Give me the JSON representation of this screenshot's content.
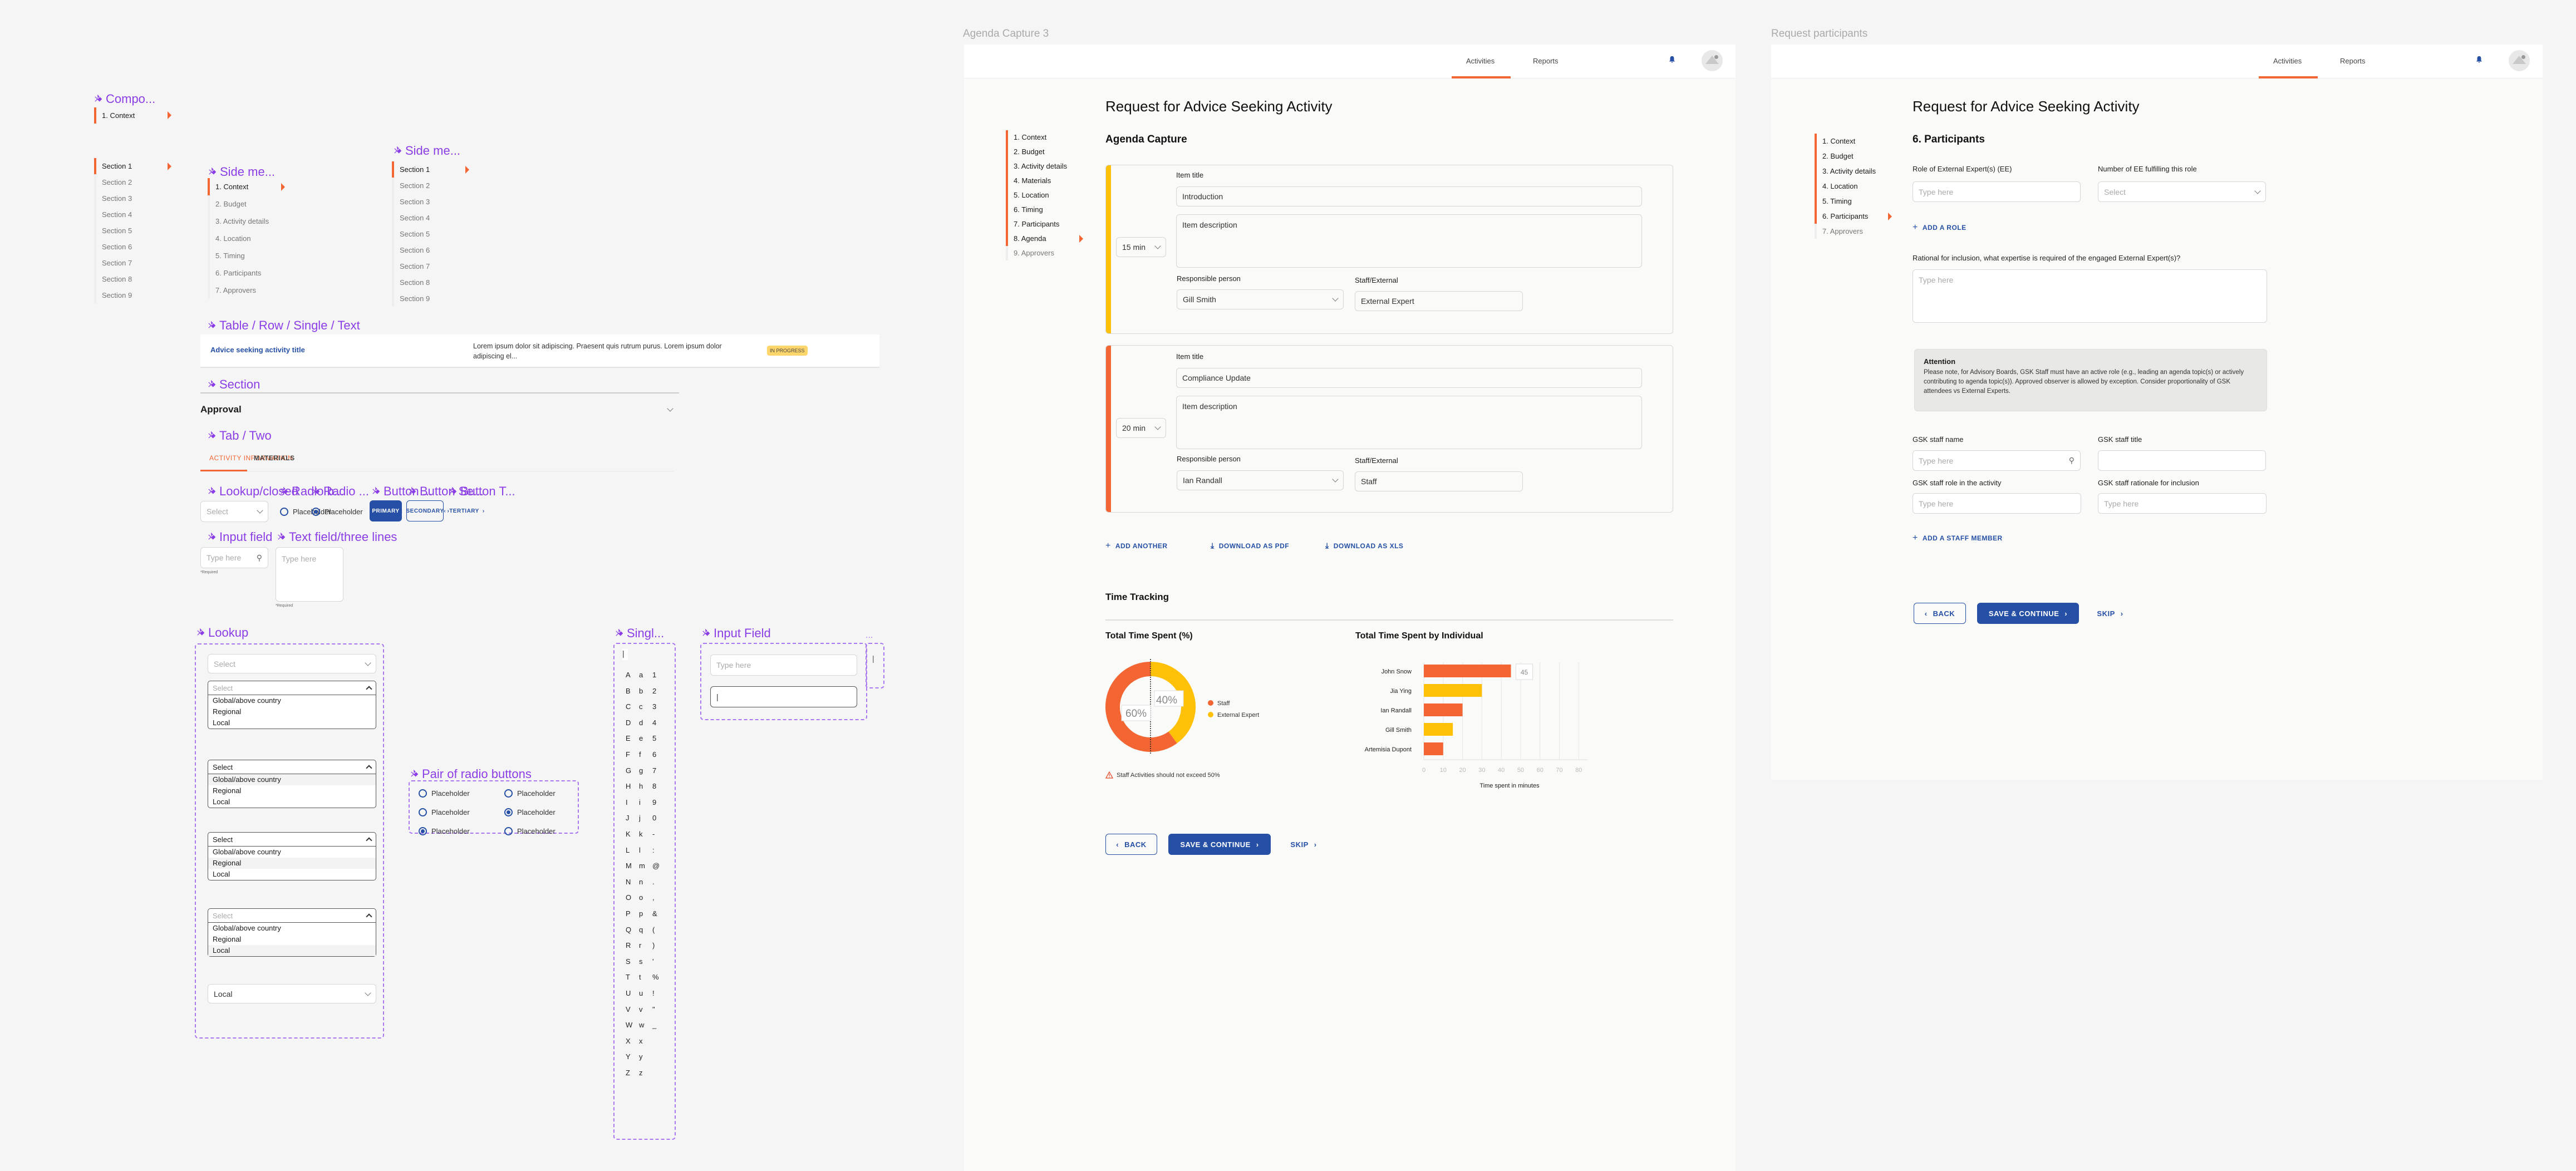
{
  "components": {
    "labels": {
      "compo": "Compo...",
      "side_menu_a": "Side me...",
      "side_menu_b": "Side me...",
      "table_row": "Table / Row / Single / Text",
      "section": "Section",
      "tab_two": "Tab / Two",
      "lookup_closed": "Lookup/closed",
      "radio_b": "Radio b...",
      "radio_c": "Radio ...",
      "button_p": "Button ...",
      "button_s": "Button Se...",
      "button_t": "Button T...",
      "input_field": "Input field",
      "text_field_three": "Text field/three lines",
      "lookup": "Lookup",
      "pair_radio": "Pair of radio buttons",
      "single": "Singl...",
      "input_field_b": "Input Field",
      "ellipsis": "..."
    },
    "compo_item": "1. Context",
    "sections_nav": [
      "Section 1",
      "Section 2",
      "Section 3",
      "Section 4",
      "Section 5",
      "Section 6",
      "Section 7",
      "Section 8",
      "Section 9"
    ],
    "steps_nav": [
      "1. Context",
      "2. Budget",
      "3. Activity details",
      "4. Location",
      "5. Timing",
      "6. Participants",
      "7. Approvers"
    ],
    "table_row": {
      "title": "Advice seeking activity title",
      "description": "Lorem ipsum dolor sit adipiscing. Praesent quis rutrum purus. Lorem ipsum dolor adipiscing el...",
      "status": "IN PROGRESS"
    },
    "section_title": "Approval",
    "tabs": [
      "ACTIVITY INFORMATION",
      "MATERIALS"
    ],
    "select_placeholder": "Select",
    "radio_label": "Placeholder",
    "buttons": {
      "primary": "PRIMARY",
      "secondary": "SECONDARY",
      "tertiary": "TERTIARY"
    },
    "input_placeholder": "Type here",
    "required": "*Required",
    "lookup_options": [
      "Global/above country",
      "Regional",
      "Local"
    ],
    "lookup_selected": "Local",
    "charset_upper": [
      "A",
      "B",
      "C",
      "D",
      "E",
      "F",
      "G",
      "H",
      "I",
      "J",
      "K",
      "L",
      "M",
      "N",
      "O",
      "P",
      "Q",
      "R",
      "S",
      "T",
      "U",
      "V",
      "W",
      "X",
      "Y",
      "Z"
    ],
    "charset_lower": [
      "a",
      "b",
      "c",
      "d",
      "e",
      "f",
      "g",
      "h",
      "i",
      "j",
      "k",
      "l",
      "m",
      "n",
      "o",
      "p",
      "q",
      "r",
      "s",
      "t",
      "u",
      "v",
      "w",
      "x",
      "y",
      "z"
    ],
    "charset_sym": [
      "1",
      "2",
      "3",
      "4",
      "5",
      "6",
      "7",
      "8",
      "9",
      "0",
      "-",
      ":",
      "@",
      ".",
      ",",
      "&",
      "(",
      ")",
      "'",
      "%",
      "!",
      "\"",
      "_"
    ]
  },
  "agenda": {
    "frame_title": "Agenda Capture 3",
    "nav_tabs": [
      "Activities",
      "Reports"
    ],
    "page_title": "Request for Advice Seeking Activity",
    "section_title": "Agenda Capture",
    "steps": [
      "1. Context",
      "2. Budget",
      "3. Activity details",
      "4. Materials",
      "5. Location",
      "6. Timing",
      "7. Participants",
      "8. Agenda",
      "9. Approvers"
    ],
    "item_title_label": "Item title",
    "item_description_placeholder": "Item description",
    "responsible_label": "Responsible person",
    "staff_external_label": "Staff/External",
    "items": [
      {
        "duration": "15 min",
        "title": "Introduction",
        "responsible": "Gill Smith",
        "staff_external": "External Expert",
        "color": "#ffc107"
      },
      {
        "duration": "20 min",
        "title": "Compliance Update",
        "responsible": "Ian Randall",
        "staff_external": "Staff",
        "color": "#f36633"
      }
    ],
    "actions": [
      "ADD ANOTHER",
      "DOWNLOAD AS PDF",
      "DOWNLOAD AS XLS"
    ],
    "time_tracking_title": "Time Tracking",
    "warning": "Staff Activities should not exceed 50%",
    "back": "BACK",
    "save": "SAVE & CONTINUE",
    "skip": "SKIP"
  },
  "chart_data": [
    {
      "type": "pie",
      "title": "Total Time Spent (%)",
      "categories": [
        "Staff",
        "External Experts"
      ],
      "values": [
        60,
        40
      ],
      "labels": [
        "60%",
        "40%"
      ],
      "colors": [
        "#f36633",
        "#ffc107"
      ],
      "legend": "right",
      "threshold": 50
    },
    {
      "type": "bar",
      "orientation": "horizontal",
      "title": "Total Time Spent by Individual",
      "categories": [
        "John Snow",
        "Jia Ying",
        "Ian Randall",
        "Gill Smith",
        "Artemisia Dupont"
      ],
      "values": [
        45,
        30,
        20,
        15,
        10
      ],
      "groups": [
        "Staff",
        "External Experts",
        "Staff",
        "External Experts",
        "Staff"
      ],
      "xlabel": "Time spent in minutes",
      "ylabel": "",
      "xlim": [
        0,
        80
      ],
      "xticks": [
        0,
        10,
        20,
        30,
        40,
        50,
        60,
        70,
        80
      ],
      "data_label": "45",
      "legend": [
        "Staff",
        "External Experts"
      ],
      "colors": {
        "Staff": "#f36633",
        "External Experts": "#ffc107"
      },
      "grid": true
    }
  ],
  "participants": {
    "frame_title": "Request participants",
    "nav_tabs": [
      "Activities",
      "Reports"
    ],
    "page_title": "Request for Advice Seeking Activity",
    "section_title": "6. Participants",
    "steps": [
      "1. Context",
      "2. Budget",
      "3. Activity details",
      "4. Location",
      "5. Timing",
      "6. Participants",
      "7. Approvers"
    ],
    "role_label": "Role of External Expert(s) (EE)",
    "number_label": "Number of EE fulfilling this role",
    "type_here": "Type here",
    "select": "Select",
    "add_role": "ADD A ROLE",
    "rational_label": "Rational for inclusion, what expertise is required of the engaged External Expert(s)?",
    "attention_title": "Attention",
    "attention_body": "Please note, for Advisory Boards, GSK Staff must have an active role (e.g., leading an agenda topic(s) or actively contributing to agenda topic(s)). Approved observer is allowed by exception. Consider proportionality of GSK attendees vs External Experts.",
    "staff_name_label": "GSK staff name",
    "staff_title_label": "GSK staff title",
    "staff_role_label": "GSK staff role in the activity",
    "staff_rationale_label": "GSK staff rationale for inclusion",
    "add_staff": "ADD A STAFF MEMBER",
    "back": "BACK",
    "save": "SAVE & CONTINUE",
    "skip": "SKIP"
  }
}
